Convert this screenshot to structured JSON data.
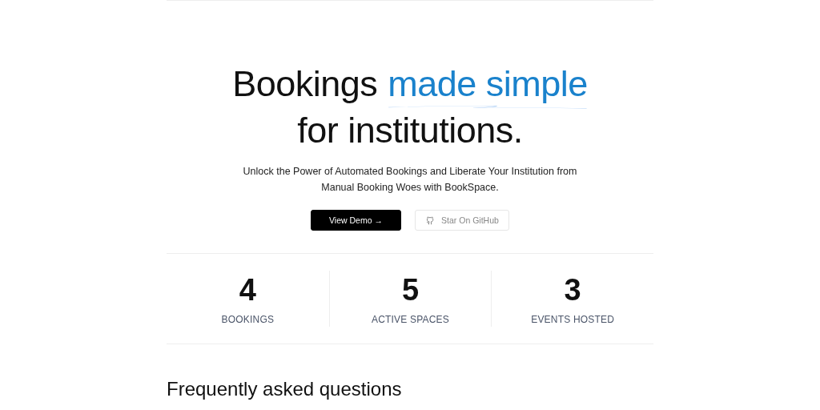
{
  "hero": {
    "headline_lines": [
      [
        {
          "text": "Bookings",
          "accent": false
        },
        {
          "text": "made simple",
          "accent": true
        }
      ],
      [
        {
          "text": "for institutions.",
          "accent": false
        }
      ]
    ],
    "subtitle": "Unlock the Power of Automated Bookings and Liberate Your Institution from Manual Booking Woes with BookSpace.",
    "buttons": [
      {
        "label": "View Demo →",
        "kind": "primary"
      },
      {
        "label": "Star On GitHub",
        "kind": "github"
      }
    ]
  },
  "stats": [
    {
      "value": "4",
      "label": "BOOKINGS"
    },
    {
      "value": "5",
      "label": "ACTIVE SPACES"
    },
    {
      "value": "3",
      "label": "EVENTS HOSTED"
    }
  ],
  "faq": {
    "title": "Frequently asked questions"
  }
}
